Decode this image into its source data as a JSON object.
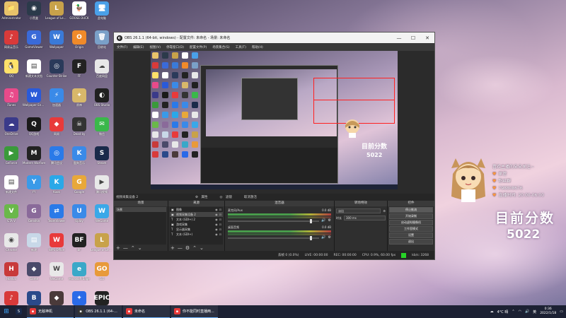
{
  "desktop": {
    "icons": [
      {
        "label": "Administrator",
        "color": "#e8c36a",
        "glyph": "📁"
      },
      {
        "label": "小黑盒",
        "color": "#2b3a4a",
        "glyph": "◉"
      },
      {
        "label": "League of Legends",
        "color": "#c8a24a",
        "glyph": "L"
      },
      {
        "label": "GOOSE DUCK",
        "color": "#fff",
        "glyph": "🦆"
      },
      {
        "label": "此电脑",
        "color": "#4aa0e8",
        "glyph": "🖥"
      },
      {
        "label": "网易云音乐",
        "color": "#d83a3a",
        "glyph": "♪"
      },
      {
        "label": "GameViewer",
        "color": "#3a6ad8",
        "glyph": "G"
      },
      {
        "label": "Wallpaper",
        "color": "#3a7ad8",
        "glyph": "W"
      },
      {
        "label": "Origin",
        "color": "#f08a2a",
        "glyph": "O"
      },
      {
        "label": "回收站",
        "color": "#7aa0c8",
        "glyph": "🗑"
      },
      {
        "label": "QQ",
        "color": "#ffe16a",
        "glyph": "🐧"
      },
      {
        "label": "新建文本文档",
        "color": "#ffffff",
        "glyph": "▤"
      },
      {
        "label": "Counter-Strike",
        "color": "#2a3a5a",
        "glyph": "◎"
      },
      {
        "label": "FF",
        "color": "#222",
        "glyph": "F"
      },
      {
        "label": "百度网盘",
        "color": "#e8e8e8",
        "glyph": "☁"
      },
      {
        "label": "iTunes",
        "color": "#e84a8a",
        "glyph": "♫"
      },
      {
        "label": "Wallpaper Engine",
        "color": "#2a5ad8",
        "glyph": "W"
      },
      {
        "label": "加速器",
        "color": "#3a8ae8",
        "glyph": "⚡"
      },
      {
        "label": "原神",
        "color": "#d8b86a",
        "glyph": "✦"
      },
      {
        "label": "OBS Studio",
        "color": "#202020",
        "glyph": "◐"
      },
      {
        "label": "OneDrive",
        "color": "#3a3a8a",
        "glyph": "☁"
      },
      {
        "label": "QQ游戏",
        "color": "#1a1a1a",
        "glyph": "Q"
      },
      {
        "label": "网易",
        "color": "#e83a3a",
        "glyph": "◆"
      },
      {
        "label": "Dead by",
        "color": "#333",
        "glyph": "☠"
      },
      {
        "label": "微信",
        "color": "#3ab84a",
        "glyph": "✉"
      },
      {
        "label": "GeForce",
        "color": "#3a9a3a",
        "glyph": "▶"
      },
      {
        "label": "Modern Warfare",
        "color": "#222",
        "glyph": "M"
      },
      {
        "label": "腾讯会议",
        "color": "#2a7ae8",
        "glyph": "◎"
      },
      {
        "label": "酷狗音乐",
        "color": "#3a8ae8",
        "glyph": "K"
      },
      {
        "label": "Steam",
        "color": "#1a2a4a",
        "glyph": "S"
      },
      {
        "label": "新建文件",
        "color": "#ffffff",
        "glyph": "▤"
      },
      {
        "label": "YY",
        "color": "#3a9ae8",
        "glyph": "Y"
      },
      {
        "label": "Kook",
        "color": "#2aa8e8",
        "glyph": "K"
      },
      {
        "label": "Google",
        "color": "#e8a83a",
        "glyph": "G"
      },
      {
        "label": "腾讯视频",
        "color": "#e8e8e8",
        "glyph": "▶"
      },
      {
        "label": "GTA V",
        "color": "#6ab84a",
        "glyph": "V"
      },
      {
        "label": "Genshin",
        "color": "#8a6a9a",
        "glyph": "G"
      },
      {
        "label": "TeamViewer",
        "color": "#2a7ae8",
        "glyph": "⇄"
      },
      {
        "label": "Uplay",
        "color": "#3a8ae8",
        "glyph": "U"
      },
      {
        "label": "WeGame",
        "color": "#3aa8e8",
        "glyph": "W"
      },
      {
        "label": "Chrome",
        "color": "#e8e8e8",
        "glyph": "◉"
      },
      {
        "label": "新建",
        "color": "#c8d8e8",
        "glyph": "▤"
      },
      {
        "label": "WPS Office",
        "color": "#e83a3a",
        "glyph": "W"
      },
      {
        "label": "BF",
        "color": "#222",
        "glyph": "BF"
      },
      {
        "label": "League of Legends",
        "color": "#c8a24a",
        "glyph": "L"
      },
      {
        "label": "Honkai",
        "color": "#c83a3a",
        "glyph": "H"
      },
      {
        "label": "Game",
        "color": "#4a4a6a",
        "glyph": "◆"
      },
      {
        "label": "WeGame",
        "color": "#e8e8e8",
        "glyph": "W"
      },
      {
        "label": "Microsoft Edge",
        "color": "#3aa8c8",
        "glyph": "e"
      },
      {
        "label": "GO",
        "color": "#e89a3a",
        "glyph": "GO"
      },
      {
        "label": "网易云音乐",
        "color": "#d83a3a",
        "glyph": "♪"
      },
      {
        "label": "Battle.net",
        "color": "#2a4a8a",
        "glyph": "B"
      },
      {
        "label": "Game",
        "color": "#4a3a3a",
        "glyph": "◆"
      },
      {
        "label": "腾讯",
        "color": "#2a6ae8",
        "glyph": "✦"
      },
      {
        "label": "Epic Games",
        "color": "#222",
        "glyph": "EPIC"
      }
    ]
  },
  "obs": {
    "title": "OBS 26.1.1 (64-bit, windows) - 配置文件: 未命名 - 场景: 未命名",
    "menu": [
      "文件(F)",
      "编辑(E)",
      "视图(V)",
      "停靠窗口(D)",
      "配置文件(P)",
      "场景集合(S)",
      "工具(T)",
      "帮助(H)"
    ],
    "preview": {
      "score_label": "目前分数",
      "score_value": "5022"
    },
    "status_strip": {
      "source_label": "视频采集设备 2",
      "properties": "属性",
      "filters": "滤镜",
      "deactivate": "取消激活"
    },
    "docks": {
      "scenes_title": "场景",
      "scenes": [
        "场景"
      ],
      "sources_title": "来源",
      "sources": [
        {
          "icon": "▣",
          "name": "图像"
        },
        {
          "icon": "▣",
          "name": "视频采集设备 2"
        },
        {
          "icon": "T",
          "name": "文本 (GDI+) 2"
        },
        {
          "icon": "▣",
          "name": "游戏采集"
        },
        {
          "icon": "T",
          "name": "显示器采集"
        },
        {
          "icon": "T",
          "name": "文本 (GDI+)"
        }
      ],
      "mixer_title": "混音器",
      "mixer": [
        {
          "name": "麦克风/Aux",
          "db": "0.0 dB"
        },
        {
          "name": "桌面音频",
          "db": "0.0 dB"
        }
      ],
      "transitions_title": "转场特效",
      "transition": "淡出",
      "duration_label": "时长",
      "duration_value": "300 ms",
      "controls_title": "控件",
      "controls": [
        "停止推流",
        "开始录制",
        "启动虚拟摄像机",
        "工作室模式",
        "设置",
        "退出"
      ]
    },
    "statusbar": {
      "dropped": "丢帧 0 (0.0%)",
      "live": "LIVE: 00:00:00",
      "rec": "REC: 00:00:00",
      "cpu": "CPU: 0.9%, 60.00 fps",
      "kbps": "kb/s: 3268"
    }
  },
  "overlay": {
    "welcome": "喜欢主播的朵朵关注~",
    "rows": [
      {
        "badge": "♥",
        "text": "家管"
      },
      {
        "badge": "♥",
        "text": "粉丝群"
      },
      {
        "badge": "♥",
        "text": "798808676"
      },
      {
        "badge": "♥",
        "text": "直播时间: 20:00-06:00"
      }
    ],
    "score_label": "目前分数",
    "score_value": "5022"
  },
  "taskbar": {
    "items": [
      {
        "label": "无敌神机",
        "color": "#e83a3a"
      },
      {
        "label": "OBS 26.1.1 (64-bit...",
        "color": "#333"
      },
      {
        "label": "未命名",
        "color": "#e83a3a"
      },
      {
        "label": "你不能同时直播两...",
        "color": "#e83a3a"
      }
    ],
    "weather": "4°C 晴",
    "lang": "英",
    "time": "0:36",
    "date": "2022/1/18"
  }
}
